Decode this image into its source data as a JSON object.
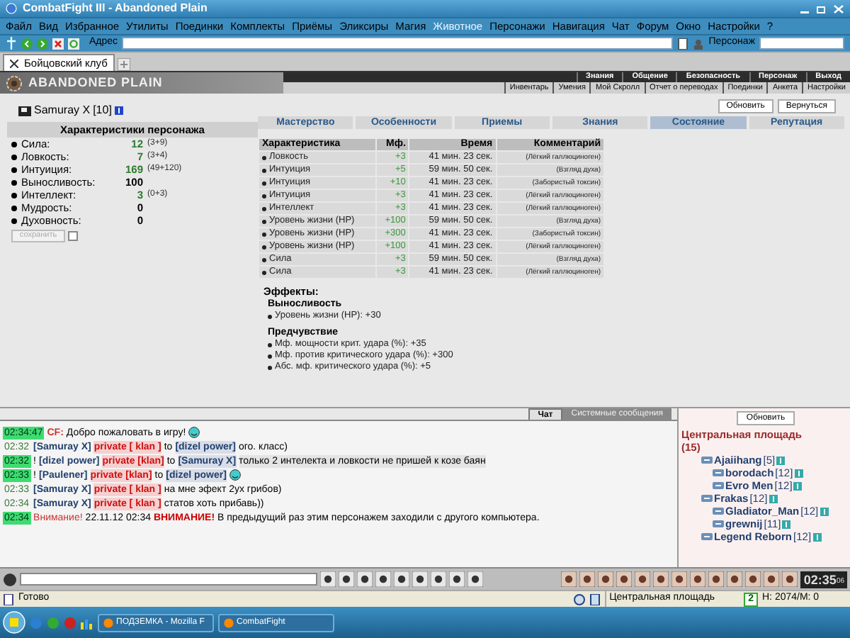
{
  "window": {
    "title": "CombatFight III - Abandoned Plain"
  },
  "menu": [
    {
      "label": "Файл",
      "selected": false
    },
    {
      "label": "Вид",
      "selected": false
    },
    {
      "label": "Избранное",
      "selected": false
    },
    {
      "label": "Утилиты",
      "selected": false
    },
    {
      "label": "Поединки",
      "selected": false
    },
    {
      "label": "Комплекты",
      "selected": false
    },
    {
      "label": "Приёмы",
      "selected": false
    },
    {
      "label": "Эликсиры",
      "selected": false
    },
    {
      "label": "Магия",
      "selected": false
    },
    {
      "label": "Животное",
      "selected": true
    },
    {
      "label": "Персонажи",
      "selected": false
    },
    {
      "label": "Навигация",
      "selected": false
    },
    {
      "label": "Чат",
      "selected": false
    },
    {
      "label": "Форум",
      "selected": false
    },
    {
      "label": "Окно",
      "selected": false
    },
    {
      "label": "Настройки",
      "selected": false
    },
    {
      "label": "?",
      "selected": false
    }
  ],
  "address_bar": {
    "label": "Адрес",
    "persona_label": "Персонаж"
  },
  "tabs": [
    {
      "label": "Бойцовский клуб",
      "selected": true
    }
  ],
  "game": {
    "logo": "ABANDONED PLAIN",
    "nav_top": [
      "Знания",
      "Общение",
      "Безопасность",
      "Персонаж",
      "Выход"
    ],
    "nav_bottom": [
      "Инвентарь",
      "Умения",
      "Мой Скролл",
      "Отчет о переводах",
      "Поединки",
      "Анкета",
      "Настройки"
    ]
  },
  "character": {
    "name": "Samuray X",
    "level": "[10]",
    "stats_title": "Характеристики персонажа",
    "stats": [
      {
        "name": "Сила:",
        "value": "12",
        "detail": "(3+9)",
        "boosted": true
      },
      {
        "name": "Ловкость:",
        "value": "7",
        "detail": "(3+4)",
        "boosted": true
      },
      {
        "name": "Интуиция:",
        "value": "169",
        "detail": "(49+120)",
        "boosted": true
      },
      {
        "name": "Выносливость:",
        "value": "100",
        "boosted": false
      },
      {
        "name": "Интеллект:",
        "value": "3",
        "detail": "(0+3)",
        "boosted": true
      },
      {
        "name": "Мудрость:",
        "value": "0",
        "boosted": false
      },
      {
        "name": "Духовность:",
        "value": "0",
        "boosted": false
      }
    ],
    "save_button": "сохранить",
    "lock_checked": false
  },
  "buttons": [
    "Обновить",
    "Вернуться"
  ],
  "section_tabs": [
    {
      "label": "Мастерство",
      "selected": false
    },
    {
      "label": "Особенности",
      "selected": false
    },
    {
      "label": "Приемы",
      "selected": false
    },
    {
      "label": "Знания",
      "selected": false
    },
    {
      "label": "Состояние",
      "selected": true
    },
    {
      "label": "Репутация",
      "selected": false
    }
  ],
  "effects_table": {
    "columns": [
      "Характеристика",
      "Мф.",
      "Время",
      "Комментарий"
    ],
    "rows": [
      {
        "name": "Ловкость",
        "mf": "+3",
        "time": "41 мин. 23 сек.",
        "comment": "(Лёгкий галлюциноген)"
      },
      {
        "name": "Интуиция",
        "mf": "+5",
        "time": "59 мин. 50 сек.",
        "comment": "(Взгляд духа)"
      },
      {
        "name": "Интуиция",
        "mf": "+10",
        "time": "41 мин. 23 сек.",
        "comment": "(Забористый токсин)"
      },
      {
        "name": "Интуиция",
        "mf": "+3",
        "time": "41 мин. 23 сек.",
        "comment": "(Лёгкий галлюциноген)"
      },
      {
        "name": "Интеллект",
        "mf": "+3",
        "time": "41 мин. 23 сек.",
        "comment": "(Лёгкий галлюциноген)"
      },
      {
        "name": "Уровень жизни (HP)",
        "mf": "+100",
        "time": "59 мин. 50 сек.",
        "comment": "(Взгляд духа)"
      },
      {
        "name": "Уровень жизни (HP)",
        "mf": "+300",
        "time": "41 мин. 23 сек.",
        "comment": "(Забористый токсин)"
      },
      {
        "name": "Уровень жизни (HP)",
        "mf": "+100",
        "time": "41 мин. 23 сек.",
        "comment": "(Лёгкий галлюциноген)"
      },
      {
        "name": "Сила",
        "mf": "+3",
        "time": "59 мин. 50 сек.",
        "comment": "(Взгляд духа)"
      },
      {
        "name": "Сила",
        "mf": "+3",
        "time": "41 мин. 23 сек.",
        "comment": "(Лёгкий галлюциноген)"
      }
    ]
  },
  "effects": {
    "title": "Эффекты:",
    "groups": [
      {
        "name": "Выносливость",
        "items": [
          "Уровень жизни (HP): +30"
        ]
      },
      {
        "name": "Предчувствие",
        "items": [
          "Мф. мощности крит. удара (%): +35",
          "Мф. против критического удара (%): +300",
          "Абс. мф. критического удара (%): +5"
        ]
      }
    ]
  },
  "chat": {
    "tabs": [
      {
        "label": "Чат",
        "selected": true
      },
      {
        "label": "Системные сообщения",
        "selected": false
      }
    ],
    "messages": [
      {
        "kind": "greeting",
        "time": "02:34:47",
        "highlighted": true,
        "sender": "CF:",
        "text": "Добро пожаловать в игру!",
        "emoticon": true
      },
      {
        "kind": "private",
        "time": "02:32",
        "highlighted": false,
        "sender": "[Samuray X]",
        "channel": "private [ klan ]",
        "to": "to",
        "recipient": "[dizel power]",
        "text": "ого. класс)"
      },
      {
        "kind": "private",
        "time": "02:32",
        "highlighted": true,
        "flag": "!",
        "sender": "[dizel power]",
        "channel": "private [klan]",
        "to": "to",
        "recipient": "[Samuray X]",
        "text": "только 2 интелекта и ловкости не пришей к козе баян"
      },
      {
        "kind": "private",
        "time": "02:33",
        "highlighted": true,
        "flag": "!",
        "sender": "[Paulener]",
        "channel": "private [klan]",
        "to": "to",
        "recipient": "[dizel power]",
        "emoticon": true
      },
      {
        "kind": "private",
        "time": "02:33",
        "highlighted": false,
        "sender": "[Samuray X]",
        "channel": "private [ klan ]",
        "text": "на мне эфект 2ух грибов)"
      },
      {
        "kind": "private",
        "time": "02:34",
        "highlighted": false,
        "sender": "[Samuray X]",
        "channel": "private [ klan ]",
        "text": "статов хоть прибавь))"
      },
      {
        "kind": "alert",
        "time": "02:34",
        "highlighted": true,
        "sender": "Внимание!",
        "text": "22.11.12 02:34 **ВНИМАНИЕ!** В предыдущий раз этим персонажем заходили с другого компьютера."
      }
    ]
  },
  "room": {
    "refresh_button": "Обновить",
    "location": "Центральная площадь",
    "count": "(15)",
    "players": [
      {
        "name": "Ajaiihang",
        "level": "[5]"
      },
      {
        "name": "borodach",
        "level": "[12]"
      },
      {
        "name": "Evro Men",
        "level": "[12]"
      },
      {
        "name": "Frakas",
        "level": "[12]"
      },
      {
        "name": "Gladiator_Man",
        "level": "[12]"
      },
      {
        "name": "grewnij",
        "level": "[11]"
      },
      {
        "name": "Legend Reborn",
        "level": "[12]"
      }
    ]
  },
  "clock": {
    "time": "02:35",
    "seconds": "06"
  },
  "status_bar": {
    "text": "Готово",
    "location": "Центральная площадь",
    "count": "2",
    "stats": "H: 2074/M: 0"
  },
  "taskbar": {
    "items": [
      "ПОДЗЕМКА - Mozilla F",
      "CombatFight"
    ]
  }
}
